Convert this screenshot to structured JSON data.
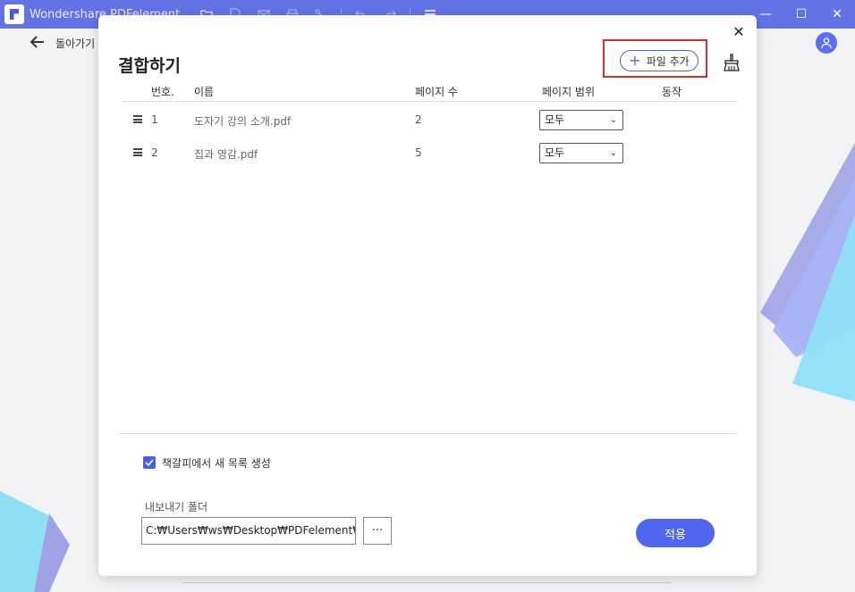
{
  "app": {
    "title": "Wondershare PDFelement"
  },
  "toolbar": {
    "icons": [
      "folder-icon",
      "page-icon",
      "mail-icon",
      "print-icon",
      "share-icon",
      "undo-icon",
      "redo-icon",
      "menu-icon"
    ]
  },
  "window_controls": {
    "minimize": "—",
    "maximize": "☐",
    "close": "✕"
  },
  "nav": {
    "back_label": "돌아가기"
  },
  "dialog": {
    "title": "결합하기",
    "add_file_label": "파일 추가",
    "close_glyph": "✕",
    "columns": {
      "number": "번호.",
      "name": "이름",
      "page_count": "페이지 수",
      "page_range": "페이지 범위",
      "action": "동작"
    },
    "files": [
      {
        "number": "1",
        "name": "도자기 강의 소개.pdf",
        "pages": "2",
        "range": "모두"
      },
      {
        "number": "2",
        "name": "집과 영감.pdf",
        "pages": "5",
        "range": "모두"
      }
    ],
    "bookmark_checkbox_label": "책갈피에서 새 목록 생성",
    "bookmark_checked": true,
    "export_folder_label": "내보내기 폴더",
    "export_folder_value": "C:₩Users₩ws₩Desktop₩PDFelement₩Com",
    "browse_label": "···",
    "apply_label": "적용"
  },
  "colors": {
    "titlebar": "#6373e6",
    "accent": "#5066ee",
    "highlight_box": "#d32f2f"
  }
}
